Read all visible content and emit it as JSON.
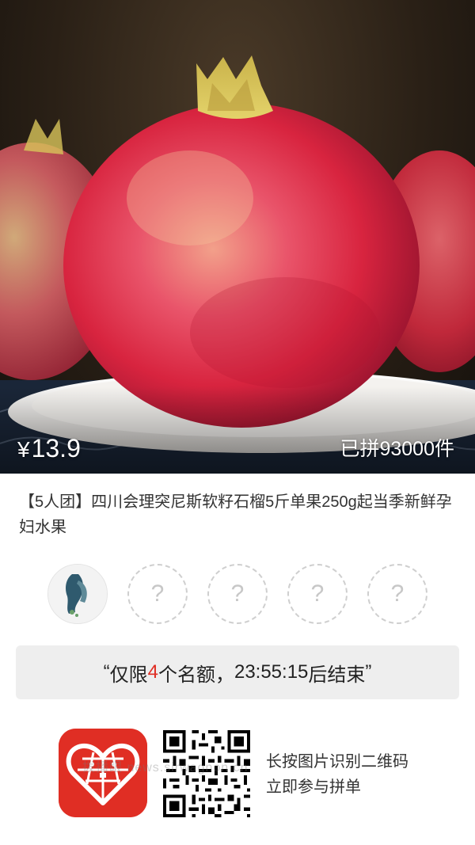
{
  "product": {
    "price_currency": "¥",
    "price_value": "13.9",
    "sold_text": "已拼93000件",
    "title": "【5人团】四川会理突尼斯软籽石榴5斤单果250g起当季新鲜孕妇水果"
  },
  "group": {
    "members": [
      {
        "state": "joined",
        "icon": "avatar"
      },
      {
        "state": "empty",
        "label": "?"
      },
      {
        "state": "empty",
        "label": "?"
      },
      {
        "state": "empty",
        "label": "?"
      },
      {
        "state": "empty",
        "label": "?"
      }
    ]
  },
  "countdown": {
    "open_quote": "“",
    "prefix": "仅限",
    "count": "4",
    "middle": "个名额，",
    "time": "23:55:15",
    "suffix": "后结束",
    "close_quote": "”"
  },
  "share": {
    "tip_line1": "长按图片识别二维码",
    "tip_line2": "立即参与拼单",
    "watermark": "拨播眼 news.sirwagnon.cn",
    "logo_icon": "pinduoduo-heart-logo",
    "qr_icon": "qr-code"
  },
  "colors": {
    "accent": "#e02e24",
    "countdown_bg": "#eeeeee"
  }
}
